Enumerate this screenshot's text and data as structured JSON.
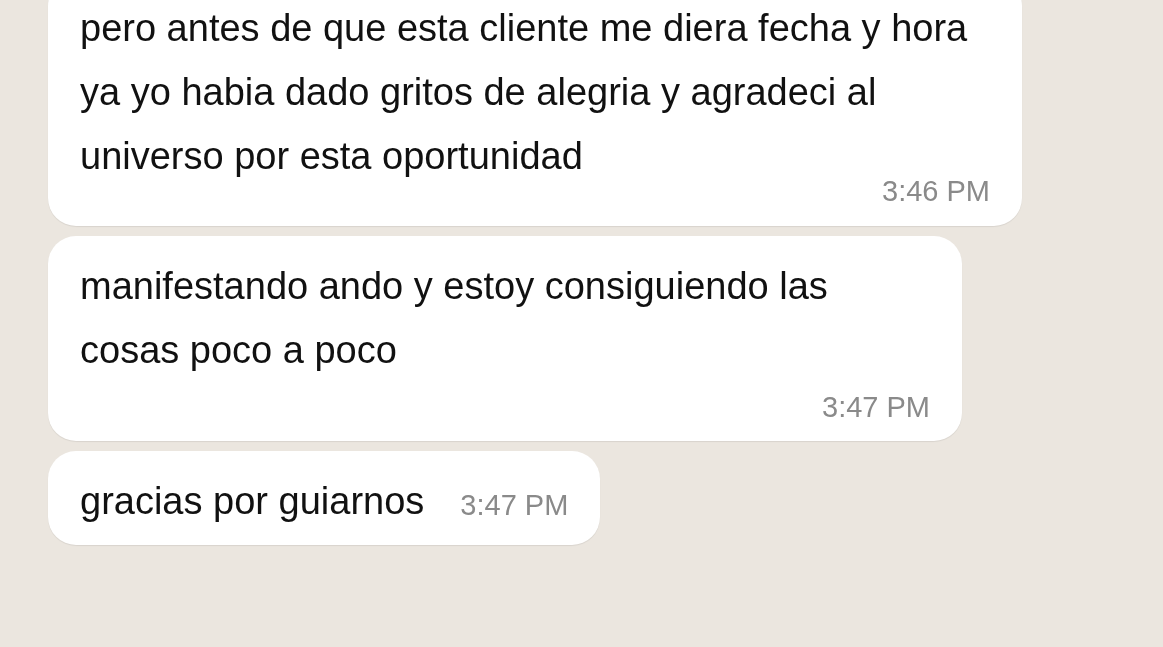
{
  "messages": [
    {
      "text": "pero antes de que esta cliente me diera fecha y hora ya yo habia dado gritos de alegria y agradeci al universo por esta oportunidad",
      "time": "3:46 PM"
    },
    {
      "text": "manifestando ando y estoy consiguiendo las cosas poco a poco",
      "time": "3:47 PM"
    },
    {
      "text": "gracias por guiarnos",
      "time": "3:47 PM"
    }
  ]
}
